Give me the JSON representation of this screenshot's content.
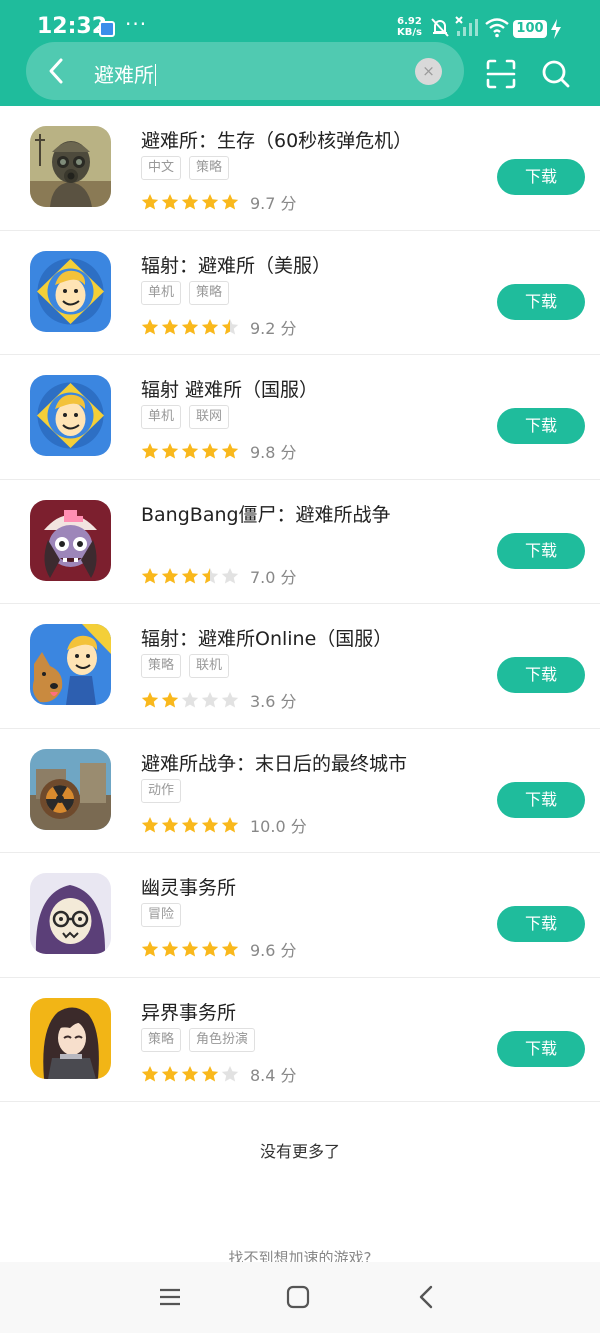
{
  "status": {
    "time": "12:32",
    "net_speed_value": "6.92",
    "net_speed_unit": "KB/s",
    "battery": "100",
    "more": "···"
  },
  "search": {
    "query": "避难所",
    "clear_symbol": "×"
  },
  "apps": [
    {
      "name": "避难所：生存（60秒核弹危机）",
      "tags": [
        "中文",
        "策略"
      ],
      "rating": 5,
      "score": "9.7 分",
      "button": "下载",
      "icon": "gas-mask-soldier-icon"
    },
    {
      "name": "辐射：避难所（美服）",
      "tags": [
        "单机",
        "策略"
      ],
      "rating": 4.5,
      "score": "9.2 分",
      "button": "下载",
      "icon": "vault-boy-icon"
    },
    {
      "name": "辐射 避难所（国服）",
      "tags": [
        "单机",
        "联网"
      ],
      "rating": 5,
      "score": "9.8 分",
      "button": "下载",
      "icon": "vault-boy-icon"
    },
    {
      "name": "BangBang僵尸：避难所战争",
      "tags": [],
      "rating": 3.5,
      "score": "7.0 分",
      "button": "下载",
      "icon": "zombie-nurse-icon"
    },
    {
      "name": "辐射：避难所Online（国服）",
      "tags": [
        "策略",
        "联机"
      ],
      "rating": 2,
      "score": "3.6 分",
      "button": "下载",
      "icon": "vault-boy-dog-icon"
    },
    {
      "name": "避难所战争：末日后的最终城市",
      "tags": [
        "动作"
      ],
      "rating": 5,
      "score": "10.0 分",
      "button": "下载",
      "icon": "radiation-fortress-icon"
    },
    {
      "name": "幽灵事务所",
      "tags": [
        "冒险"
      ],
      "rating": 5,
      "score": "9.6 分",
      "button": "下载",
      "icon": "hooded-ghost-icon"
    },
    {
      "name": "异界事务所",
      "tags": [
        "策略",
        "角色扮演"
      ],
      "rating": 4,
      "score": "8.4 分",
      "button": "下载",
      "icon": "anime-girl-icon"
    }
  ],
  "footer": {
    "no_more": "没有更多了",
    "not_found": "找不到想加速的游戏?"
  },
  "colors": {
    "accent": "#1fbc9c",
    "star": "#f9b81c",
    "star_empty": "#e2e2e2"
  }
}
